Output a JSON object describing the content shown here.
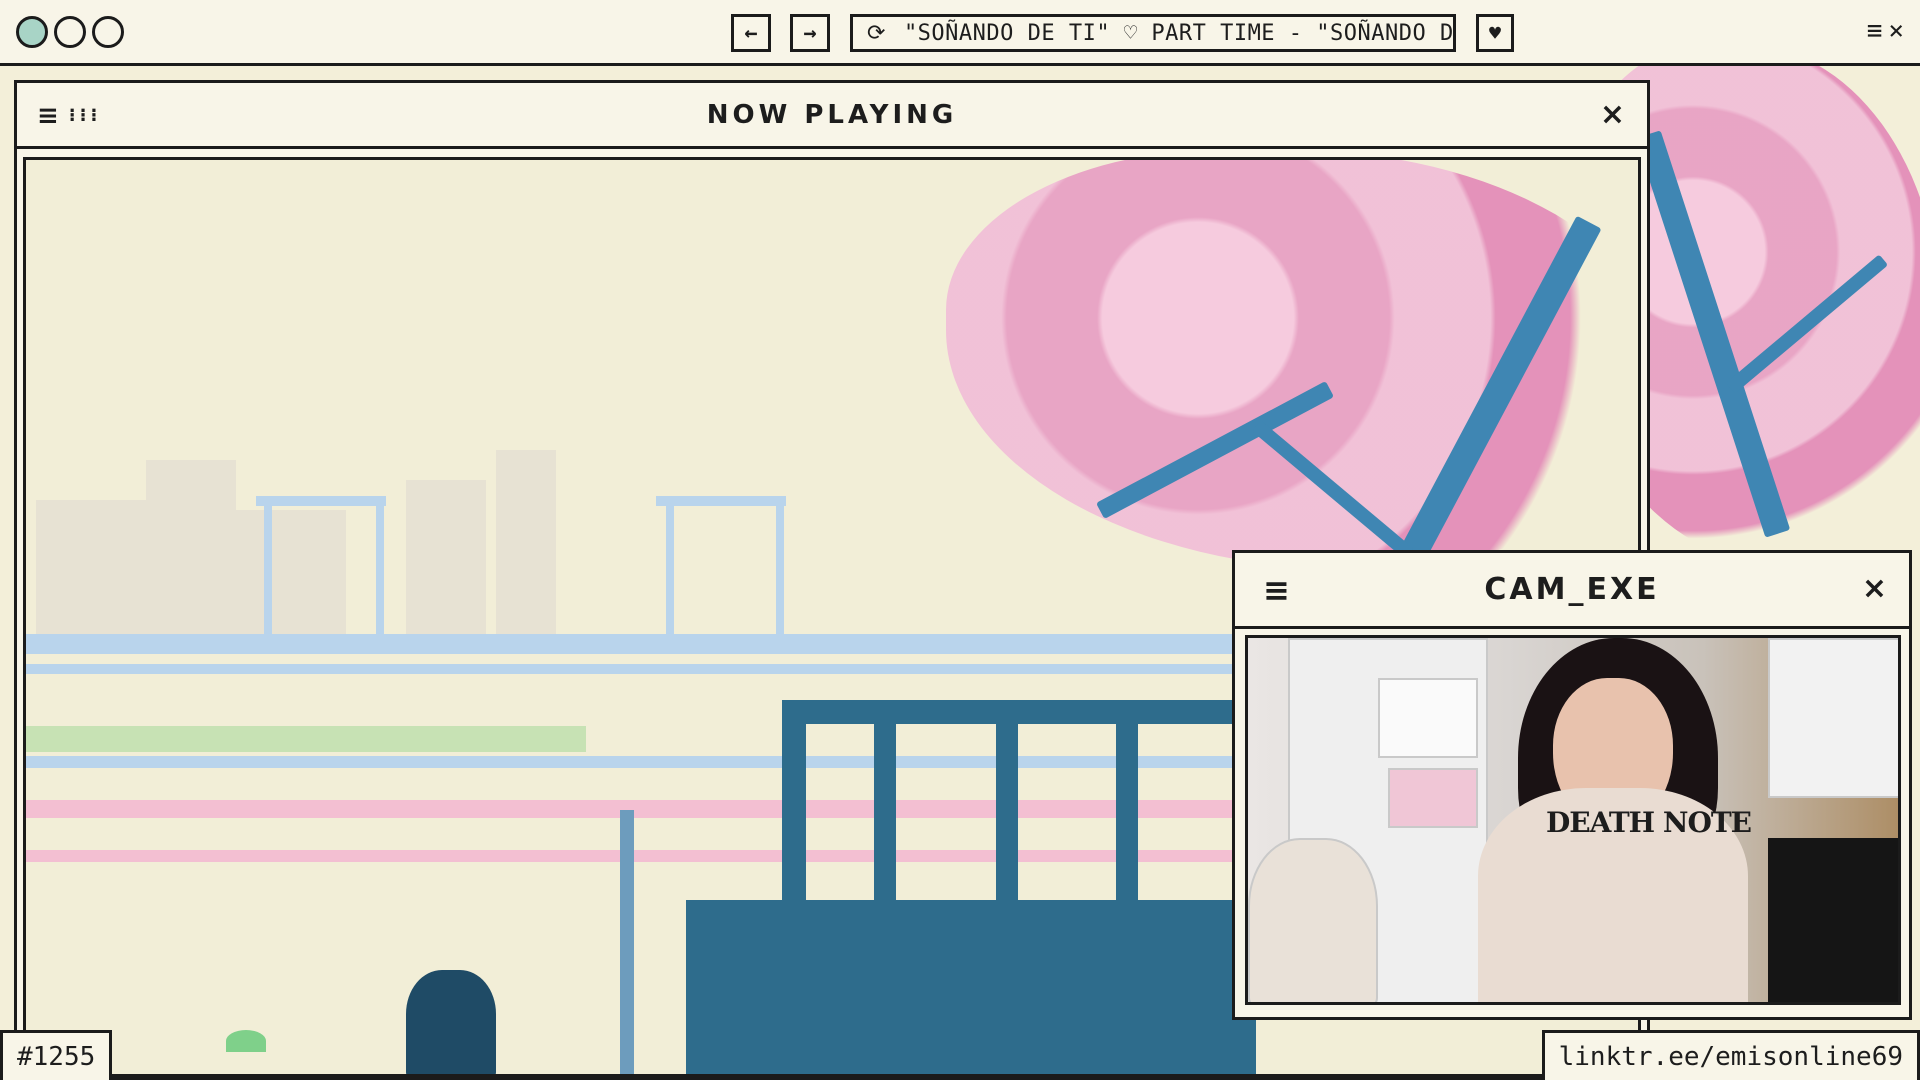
{
  "browser": {
    "back_icon": "arrow-left-icon",
    "forward_icon": "arrow-right-icon",
    "refresh_icon": "refresh-icon",
    "address_text": "\"SOÑANDO DE TI\" ♡ PART TIME - \"SOÑANDO DE TI\"",
    "bookmark_icon": "heart-icon",
    "menu_icon": "menu-icon",
    "close_icon": "close-icon",
    "back_glyph": "←",
    "forward_glyph": "→",
    "refresh_glyph": "⟳",
    "heart_glyph": "♥",
    "menu_glyph": "≡",
    "close_glyph": "×"
  },
  "now_playing": {
    "title": "NOW PLAYING",
    "menu_glyph": "≡",
    "grid_glyph": "⁝⁝⁝",
    "close_glyph": "×"
  },
  "cam": {
    "title": "CAM_EXE",
    "menu_glyph": "≡",
    "close_glyph": "×",
    "shirt_text": "DEATH NOTE"
  },
  "footer": {
    "id_label": "#1255",
    "link_label": "linktr.ee/emisonline69"
  },
  "colors": {
    "accent_teal": "#a8d4c6",
    "blossom_pink": "#e8a1c4",
    "branch_blue": "#3f86b3",
    "frame": "#1b1b1b",
    "paper": "#f8f5e8"
  }
}
